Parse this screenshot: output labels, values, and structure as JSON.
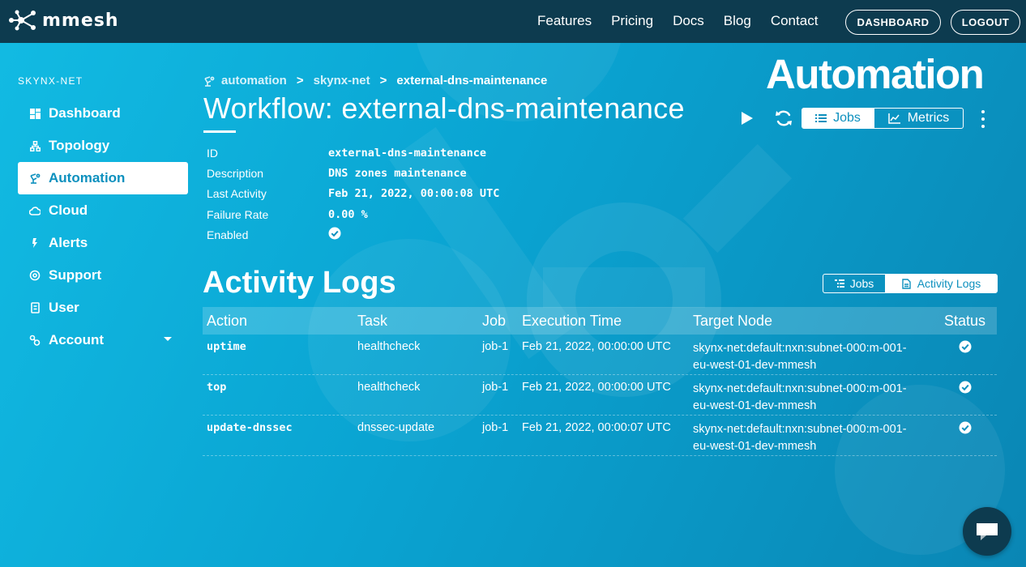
{
  "colors": {
    "topbar": "#0d3b4f",
    "accent": "#0d90be",
    "background_start": "#12bbe3",
    "background_end": "#0a86b4"
  },
  "topnav": {
    "logo_text": "mmesh",
    "links": [
      "Features",
      "Pricing",
      "Docs",
      "Blog",
      "Contact"
    ],
    "dashboard_label": "DASHBOARD",
    "logout_label": "LOGOUT"
  },
  "sidebar": {
    "network_label": "SKYNX-NET",
    "items": [
      {
        "label": "Dashboard",
        "icon": "dashboard-icon"
      },
      {
        "label": "Topology",
        "icon": "topology-icon"
      },
      {
        "label": "Automation",
        "icon": "automation-icon",
        "active": true
      },
      {
        "label": "Cloud",
        "icon": "cloud-icon"
      },
      {
        "label": "Alerts",
        "icon": "alerts-icon"
      },
      {
        "label": "Support",
        "icon": "support-icon"
      },
      {
        "label": "User",
        "icon": "user-icon"
      },
      {
        "label": "Account",
        "icon": "account-icon",
        "dropdown": true
      }
    ]
  },
  "breadcrumb": {
    "items": [
      "automation",
      "skynx-net",
      "external-dns-maintenance"
    ],
    "separator": ">"
  },
  "page_heading": "Automation",
  "workflow": {
    "title": "Workflow: external-dns-maintenance",
    "details": [
      {
        "label": "ID",
        "value": "external-dns-maintenance"
      },
      {
        "label": "Description",
        "value": "DNS zones maintenance"
      },
      {
        "label": "Last Activity",
        "value": "Feb 21, 2022, 00:00:08 UTC"
      },
      {
        "label": "Failure Rate",
        "value": "0.00 %"
      },
      {
        "label": "Enabled",
        "value": true
      }
    ],
    "view_toggle": {
      "jobs_label": "Jobs",
      "metrics_label": "Metrics",
      "active": "Jobs"
    }
  },
  "activity_logs": {
    "title": "Activity Logs",
    "view_toggle": {
      "jobs_label": "Jobs",
      "logs_label": "Activity Logs",
      "active": "Activity Logs"
    },
    "columns": [
      "Action",
      "Task",
      "Job",
      "Execution Time",
      "Target Node",
      "Status"
    ],
    "rows": [
      {
        "action": "uptime",
        "task": "healthcheck",
        "job": "job-1",
        "time": "Feb 21, 2022, 00:00:00 UTC",
        "node_line1": "skynx-net:default:nxn:subnet-000:m-001-",
        "node_line2": "eu-west-01-dev-mmesh",
        "status": "success"
      },
      {
        "action": "top",
        "task": "healthcheck",
        "job": "job-1",
        "time": "Feb 21, 2022, 00:00:00 UTC",
        "node_line1": "skynx-net:default:nxn:subnet-000:m-001-",
        "node_line2": "eu-west-01-dev-mmesh",
        "status": "success"
      },
      {
        "action": "update-dnssec",
        "task": "dnssec-update",
        "job": "job-1",
        "time": "Feb 21, 2022, 00:00:07 UTC",
        "node_line1": "skynx-net:default:nxn:subnet-000:m-001-",
        "node_line2": "eu-west-01-dev-mmesh",
        "status": "success"
      }
    ]
  }
}
